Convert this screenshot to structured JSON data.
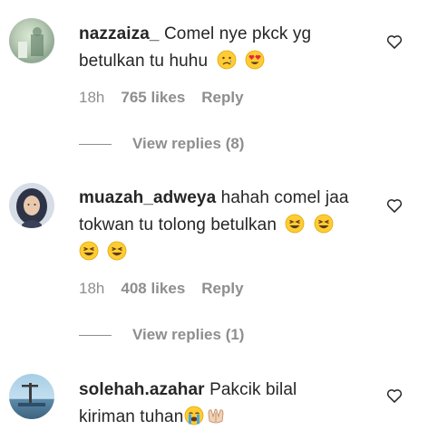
{
  "comments": [
    {
      "username": "nazzaiza_",
      "text_line1": "Comel nye pkck yg",
      "text_line2": "betulkan tu huhu",
      "emojis": [
        "crying-face",
        "heart-eyes-face"
      ],
      "time": "18h",
      "likes": "765 likes",
      "reply": "Reply",
      "view_replies": "View replies (8)"
    },
    {
      "username": "muazah_adweya",
      "text_line1": "hahah comel jaa",
      "text_line2": "tokwan tu tolong betulkan",
      "emojis": [
        "grinning-squinting-face",
        "grinning-squinting-face",
        "grinning-squinting-face",
        "grinning-squinting-face"
      ],
      "time": "18h",
      "likes": "408 likes",
      "reply": "Reply",
      "view_replies": "View replies (1)"
    },
    {
      "username": "solehah.azahar",
      "text_line1": "Pakcik bilal",
      "text_line2": "kiriman tuhan",
      "emojis": [
        "loudly-crying-face",
        "palms-up-together"
      ]
    }
  ],
  "icons": {
    "like": "heart-outline-icon"
  }
}
